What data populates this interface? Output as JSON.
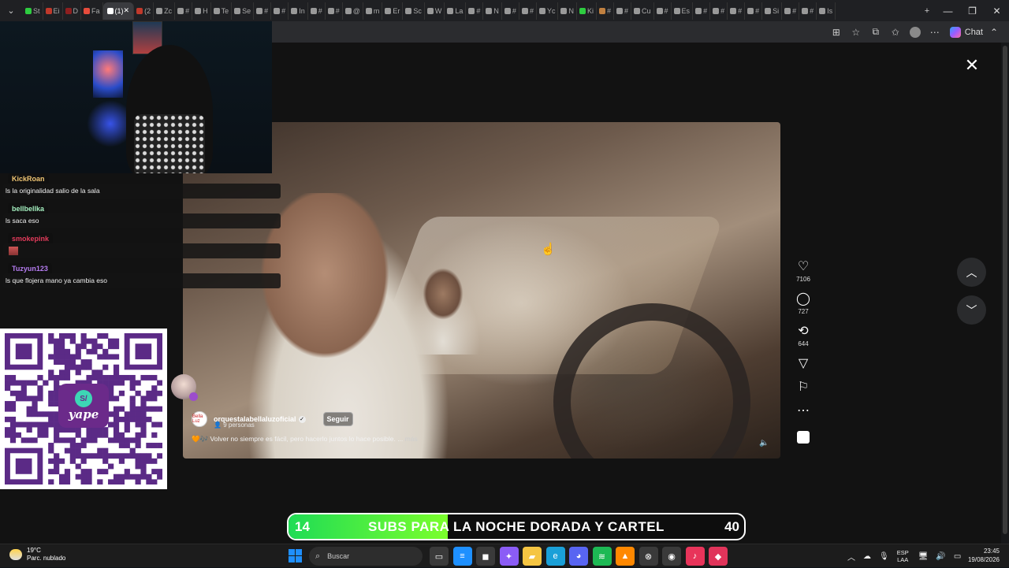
{
  "browser": {
    "tabs": [
      {
        "label": "St",
        "color": "#2ecc40"
      },
      {
        "label": "Ei",
        "color": "#c0392b"
      },
      {
        "label": "D",
        "color": "#8e1f1f"
      },
      {
        "label": "Fa",
        "color": "#e74c3c"
      },
      {
        "label": "(1)",
        "color": "#ffffff",
        "active": true
      },
      {
        "label": "(2",
        "color": "#c0392b"
      },
      {
        "label": "Zc",
        "color": "#999"
      },
      {
        "label": "#",
        "color": "#999"
      },
      {
        "label": "H",
        "color": "#999"
      },
      {
        "label": "Te",
        "color": "#999"
      },
      {
        "label": "Se",
        "color": "#999"
      },
      {
        "label": "#",
        "color": "#999"
      },
      {
        "label": "#",
        "color": "#999"
      },
      {
        "label": "In",
        "color": "#999"
      },
      {
        "label": "#",
        "color": "#999"
      },
      {
        "label": "#",
        "color": "#999"
      },
      {
        "label": "@",
        "color": "#999"
      },
      {
        "label": "m",
        "color": "#999"
      },
      {
        "label": "Er",
        "color": "#999"
      },
      {
        "label": "Sc",
        "color": "#999"
      },
      {
        "label": "W",
        "color": "#999"
      },
      {
        "label": "La",
        "color": "#999"
      },
      {
        "label": "#",
        "color": "#999"
      },
      {
        "label": "N",
        "color": "#999"
      },
      {
        "label": "#",
        "color": "#999"
      },
      {
        "label": "#",
        "color": "#999"
      },
      {
        "label": "Yc",
        "color": "#999"
      },
      {
        "label": "N",
        "color": "#999"
      },
      {
        "label": "Ki",
        "color": "#2ecc40"
      },
      {
        "label": "#",
        "color": "#c08040"
      },
      {
        "label": "#",
        "color": "#999"
      },
      {
        "label": "Cu",
        "color": "#999"
      },
      {
        "label": "#",
        "color": "#999"
      },
      {
        "label": "Es",
        "color": "#999"
      },
      {
        "label": "#",
        "color": "#999"
      },
      {
        "label": "#",
        "color": "#999"
      },
      {
        "label": "#",
        "color": "#999"
      },
      {
        "label": "#",
        "color": "#999"
      },
      {
        "label": "Si",
        "color": "#999"
      },
      {
        "label": "#",
        "color": "#999"
      },
      {
        "label": "#",
        "color": "#999"
      },
      {
        "label": "Is",
        "color": "#999"
      }
    ],
    "new_tab": "+",
    "chat_label": "Chat"
  },
  "viewer": {
    "counts": {
      "likes": "7106",
      "comments": "727",
      "reposts": "644"
    },
    "account": {
      "name": "orquestalabellaluzoficial",
      "avatar_text": "Bella Luz",
      "people": "9 personas"
    },
    "follow_label": "Seguir",
    "caption": "🧡🎶 Volver no siempre es fácil, pero hacerlo juntos lo hace posible. ...",
    "more_label": "más"
  },
  "stream": {
    "chat": [
      {
        "user": "KickRoan",
        "color": "#f0c674",
        "text": "ls la originalidad salio de la sala"
      },
      {
        "user": "bellbellka",
        "color": "#a5f0c0",
        "text": "ls saca eso"
      },
      {
        "user": "smokepink",
        "color": "#e23b5b",
        "text": "",
        "sticker": true
      },
      {
        "user": "Tuzyun123",
        "color": "#b57cf0",
        "text": "ls que flojera mano ya cambia eso"
      }
    ],
    "qr": {
      "brand": "yape",
      "symbol": "S/"
    },
    "subs_goal": {
      "current": "14",
      "target": "40",
      "title": "SUBS PARA LA NOCHE DORADA Y CARTEL",
      "progress": 0.35
    }
  },
  "taskbar": {
    "weather": {
      "temp": "19°C",
      "desc": "Parc. nublado"
    },
    "search_placeholder": "Buscar",
    "lang": {
      "line1": "ESP",
      "line2": "LAA"
    },
    "clock": {
      "time": "23:45",
      "date": "19/08/2026"
    },
    "apps": [
      {
        "name": "task-view-icon",
        "bg": "#3a3a3a",
        "glyph": "▭"
      },
      {
        "name": "notepad-icon",
        "bg": "#1e90ff",
        "glyph": "≡"
      },
      {
        "name": "store-icon",
        "bg": "#3a3a3a",
        "glyph": "◼"
      },
      {
        "name": "copilot-icon",
        "bg": "#8b5cf6",
        "glyph": "✦"
      },
      {
        "name": "file-explorer-icon",
        "bg": "#f5c542",
        "glyph": "▰"
      },
      {
        "name": "edge-icon",
        "bg": "#1aa0d8",
        "glyph": "e"
      },
      {
        "name": "discord-icon",
        "bg": "#5865f2",
        "glyph": "◕"
      },
      {
        "name": "spotify-icon",
        "bg": "#1db954",
        "glyph": "≋"
      },
      {
        "name": "vlc-icon",
        "bg": "#ff8800",
        "glyph": "▲"
      },
      {
        "name": "xbox-icon",
        "bg": "#3a3a3a",
        "glyph": "⊗"
      },
      {
        "name": "obs-icon",
        "bg": "#3a3a3a",
        "glyph": "◉"
      },
      {
        "name": "tiktok-icon",
        "bg": "#e8345a",
        "glyph": "♪"
      },
      {
        "name": "pink-app-icon",
        "bg": "#e0345a",
        "glyph": "◆"
      }
    ]
  }
}
